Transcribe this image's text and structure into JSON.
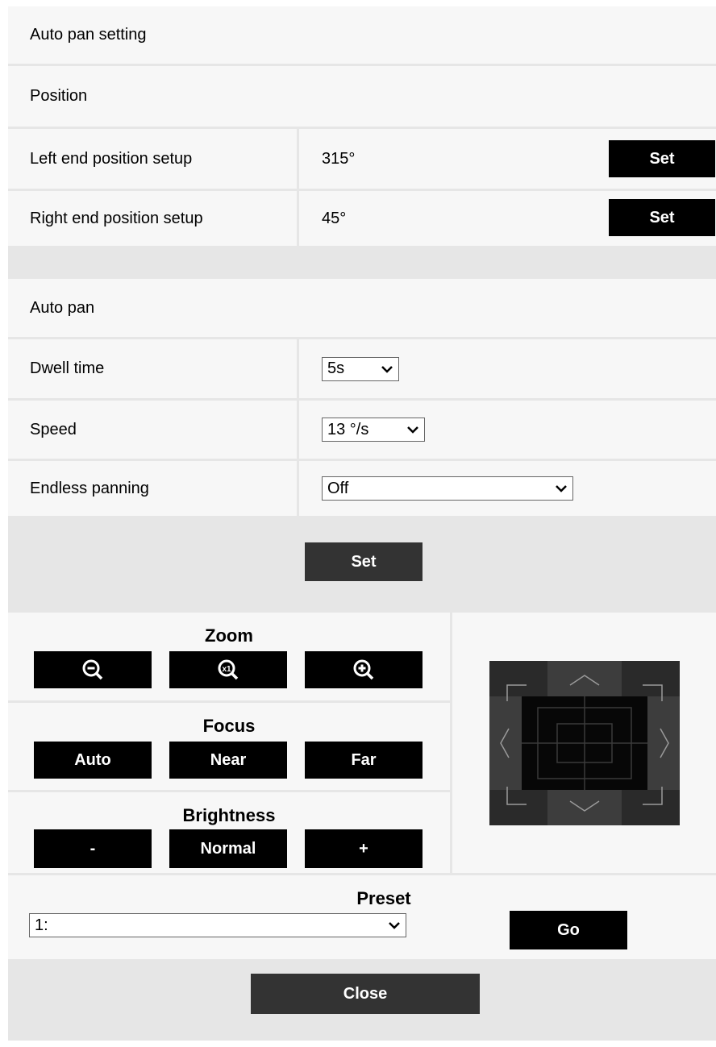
{
  "auto_pan_setting": {
    "title": "Auto pan setting"
  },
  "position": {
    "title": "Position",
    "rows": [
      {
        "label": "Left end position setup",
        "value": "315°",
        "button": "Set"
      },
      {
        "label": "Right end position setup",
        "value": "45°",
        "button": "Set"
      }
    ]
  },
  "auto_pan": {
    "title": "Auto pan",
    "dwell": {
      "label": "Dwell time",
      "value": "5s"
    },
    "speed": {
      "label": "Speed",
      "value": "13 °/s"
    },
    "endless": {
      "label": "Endless panning",
      "value": "Off"
    },
    "set_button": "Set"
  },
  "controls": {
    "zoom": {
      "label": "Zoom",
      "buttons": [
        "zoom-out-icon",
        "zoom-reset-x1-icon",
        "zoom-in-icon"
      ]
    },
    "focus": {
      "label": "Focus",
      "buttons": [
        "Auto",
        "Near",
        "Far"
      ]
    },
    "brightness": {
      "label": "Brightness",
      "buttons": [
        "-",
        "Normal",
        "+"
      ]
    }
  },
  "preset": {
    "label": "Preset",
    "value": "1:",
    "go_button": "Go"
  },
  "close_button": "Close",
  "colors": {
    "button": "#000000",
    "dark_button": "#333333",
    "panel": "#f7f7f7",
    "background": "#e6e6e6"
  }
}
